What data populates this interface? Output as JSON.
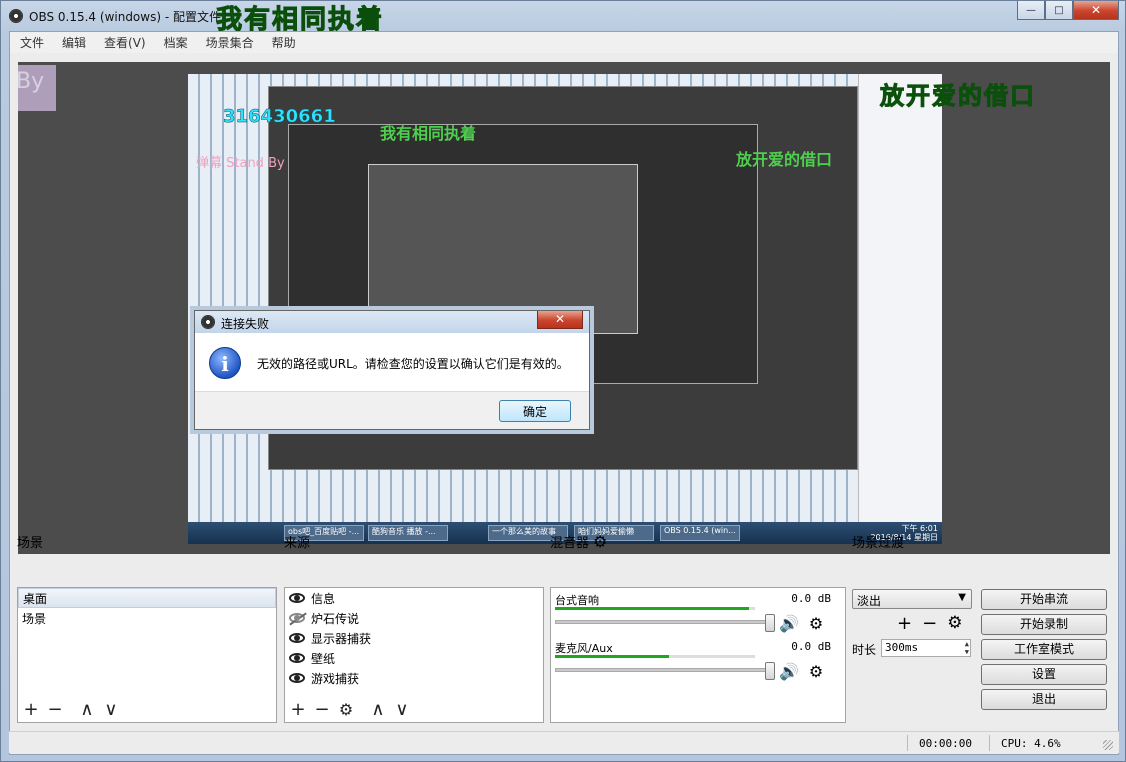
{
  "window": {
    "title": "OBS 0.15.4 (windows) - 配置文件",
    "overlay_text": "我有相同执着",
    "btn_minimize": "—",
    "btn_maximize": "□",
    "btn_close": "✕"
  },
  "menu": [
    "文件",
    "编辑",
    "查看(V)",
    "档案",
    "场景集合",
    "帮助"
  ],
  "preview": {
    "overlay_right": "放开爱的借口",
    "overlay_number": "316430661",
    "inner_overlay_1": "我有相同执着",
    "inner_overlay_2": "放开爱的借口",
    "standby_text": "弹幕 Stand By",
    "by_text": "By",
    "taskbar_items": [
      "obs吧_百度贴吧 -...",
      "酷狗音乐 播放 -...",
      "一个那么美的故事",
      "咱们妈妈爱偷懒",
      "OBS 0.15.4 (win..."
    ],
    "clock_time": "下午 6:01",
    "clock_date": "2016/8/14 星期日"
  },
  "dialog": {
    "title": "连接失败",
    "message": "无效的路径或URL。请检查您的设置以确认它们是有效的。",
    "ok_label": "确定",
    "close_label": "✕"
  },
  "scenes": {
    "title": "场景",
    "items": [
      "桌面",
      "场景"
    ],
    "selected_index": 0
  },
  "sources": {
    "title": "来源",
    "items": [
      {
        "label": "信息",
        "visible": true
      },
      {
        "label": "炉石传说",
        "visible": false
      },
      {
        "label": "显示器捕获",
        "visible": true
      },
      {
        "label": "壁纸",
        "visible": true
      },
      {
        "label": "游戏捕获",
        "visible": true
      }
    ]
  },
  "mixer": {
    "title": "混音器",
    "channels": [
      {
        "name": "台式音响",
        "level": "0.0 dB",
        "meter_fraction": 0.97
      },
      {
        "name": "麦克风/Aux",
        "level": "0.0 dB",
        "meter_fraction": 0.57
      }
    ]
  },
  "transitions": {
    "title": "场景过渡",
    "selected": "淡出",
    "duration_label": "时长",
    "duration_value": "300ms"
  },
  "controls": {
    "start_stream": "开始串流",
    "start_record": "开始录制",
    "studio_mode": "工作室模式",
    "settings": "设置",
    "exit": "退出"
  },
  "status": {
    "time": "00:00:00",
    "cpu": "CPU: 4.6%"
  },
  "icons": {
    "plus": "+",
    "minus": "−",
    "up": "∧",
    "down": "∨",
    "gear": "⚙",
    "speaker": "🔊"
  }
}
